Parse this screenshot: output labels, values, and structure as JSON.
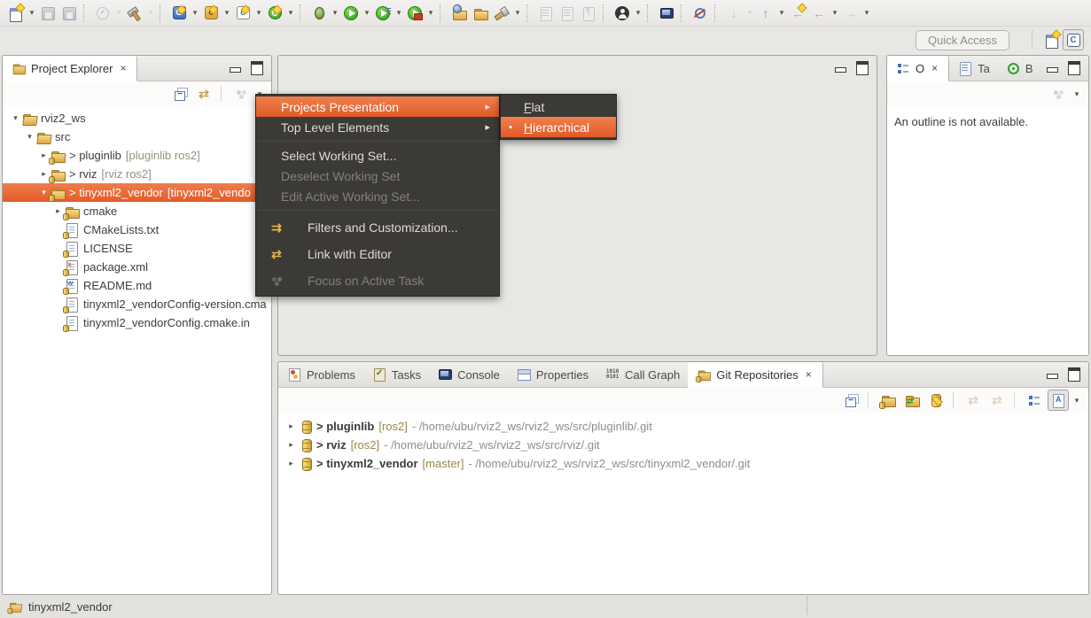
{
  "toolbar": {
    "quick_access_label": "Quick Access",
    "icons": [
      "new-wizard",
      "save",
      "save-all",
      "clock",
      "build-hammer",
      "new-cpp-project",
      "new-cpp-class",
      "new-c-file",
      "new-green-wizard",
      "debug",
      "run",
      "run-history",
      "external-tools",
      "import-projects",
      "open-folder",
      "brush",
      "block-selection",
      "show-lines",
      "show-whitespace",
      "user-account",
      "terminal",
      "search-disabled",
      "next-annotation",
      "previous-annotation",
      "last-edit-location",
      "back",
      "forward",
      "open-perspective",
      "cpp-perspective"
    ]
  },
  "project_explorer": {
    "title": "Project Explorer",
    "tree": [
      {
        "label": "rviz2_ws",
        "decoration": ""
      },
      {
        "label": "src",
        "decoration": ""
      },
      {
        "label": "> pluginlib",
        "decoration": "[pluginlib ros2]"
      },
      {
        "label": "> rviz",
        "decoration": "[rviz ros2]"
      },
      {
        "label": "> tinyxml2_vendor",
        "decoration": "[tinyxml2_vendo"
      },
      {
        "label": "cmake",
        "decoration": ""
      },
      {
        "label": "CMakeLists.txt",
        "decoration": ""
      },
      {
        "label": "LICENSE",
        "decoration": ""
      },
      {
        "label": "package.xml",
        "decoration": ""
      },
      {
        "label": "README.md",
        "decoration": ""
      },
      {
        "label": "tinyxml2_vendorConfig-version.cma",
        "decoration": ""
      },
      {
        "label": "tinyxml2_vendorConfig.cmake.in",
        "decoration": ""
      }
    ]
  },
  "context_menu": {
    "projects_presentation": "Projects Presentation",
    "top_level_elements": "Top Level Elements",
    "select_working_set": "Select Working Set...",
    "deselect_working_set": "Deselect Working Set",
    "edit_active_working_set": "Edit Active Working Set...",
    "filters": "Filters and Customization...",
    "link_with_editor": "Link with Editor",
    "focus_on_active_task": "Focus on Active Task"
  },
  "submenu": {
    "flat": {
      "m": "F",
      "rest": "lat"
    },
    "hierarchical": {
      "m": "H",
      "rest": "ierarchical"
    }
  },
  "outline": {
    "tab_outline": "O",
    "tab_tasklist": "Ta",
    "tab_breakpoints": "B",
    "message": "An outline is not available."
  },
  "bottom": {
    "tabs": [
      "Problems",
      "Tasks",
      "Console",
      "Properties",
      "Call Graph",
      "Git Repositories"
    ],
    "repos": [
      {
        "name": "> pluginlib",
        "branch": "[ros2]",
        "path": "- /home/ubu/rviz2_ws/rviz2_ws/src/pluginlib/.git"
      },
      {
        "name": "> rviz",
        "branch": "[ros2]",
        "path": "- /home/ubu/rviz2_ws/rviz2_ws/src/rviz/.git"
      },
      {
        "name": "> tinyxml2_vendor",
        "branch": "[master]",
        "path": "- /home/ubu/rviz2_ws/rviz2_ws/src/tinyxml2_vendor/.git"
      }
    ]
  },
  "statusbar": {
    "label": "tinyxml2_vendor"
  },
  "colors": {
    "selection_orange": "#E8653C",
    "menu_background": "#3B3A36",
    "menu_text": "#DFDBD3",
    "menu_disabled_text": "#84817A",
    "decoration_text": "#988F7E",
    "branch_text": "#9A8648",
    "path_text": "#8F8D8A"
  }
}
